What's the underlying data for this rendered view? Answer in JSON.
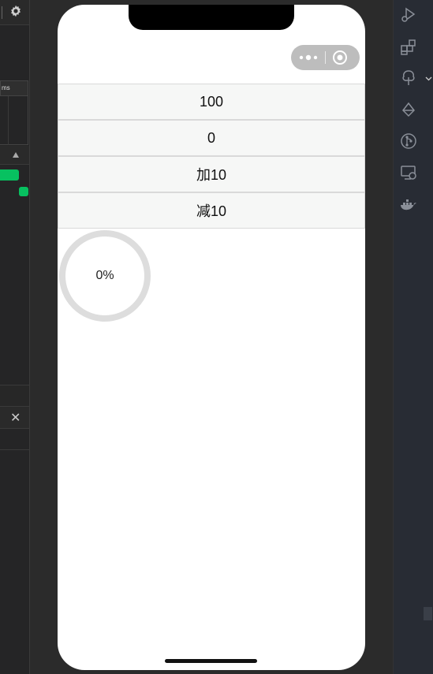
{
  "ide": {
    "left_panel": {
      "header_text": "ms"
    },
    "accent_color": "#07c160"
  },
  "phone": {
    "buttons": [
      {
        "label": "100"
      },
      {
        "label": "0"
      },
      {
        "label": "加10"
      },
      {
        "label": "减10"
      }
    ],
    "progress": {
      "value_percent": 0,
      "label": "0%",
      "track_color": "#dddddd"
    },
    "capsule_icons": [
      "more-icon",
      "target-icon"
    ]
  },
  "activity_bar": {
    "icons": [
      "run-debug-icon",
      "extensions-icon",
      "tree-icon",
      "deploy-icon",
      "git-branch-icon",
      "remote-screen-icon",
      "docker-icon"
    ]
  }
}
